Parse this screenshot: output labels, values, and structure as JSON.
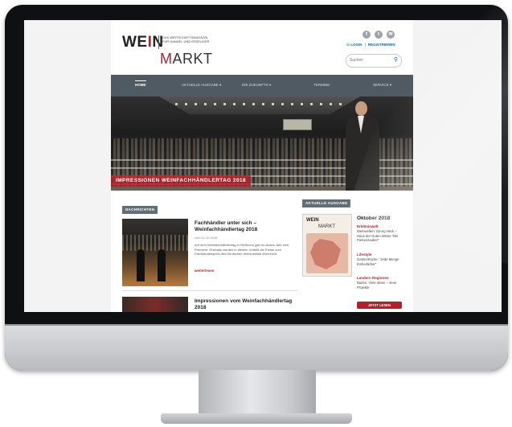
{
  "header": {
    "logo_wein": "WEIN",
    "logo_tagline": "DAS WIRTSCHAFTSMAGAZIN FÜR HANDEL UND ERZEUGER",
    "logo_markt": "MARKT",
    "social_icons": [
      "facebook-icon",
      "twitter-icon",
      "mail-icon"
    ],
    "login_label": "LOGIN",
    "register_label": "REGISTRIEREN",
    "search_placeholder": "Suchen"
  },
  "nav": {
    "items": [
      {
        "label": "HOME"
      },
      {
        "label": "AKTUELLE AUSGABE ▾"
      },
      {
        "label": "DIE ZUKUNFTS ▾"
      },
      {
        "label": "TERMINE"
      },
      {
        "label": "SERVICE ▾"
      }
    ]
  },
  "hero": {
    "caption": "IMPRESSIONEN WEINFACHHÄNDLERTAG 2018"
  },
  "news": {
    "section_label": "NACHRICHTEN",
    "articles": [
      {
        "title": "Fachhändler unter sich – Weinfachhändlertag 2018",
        "date": "vom 11.10.2018",
        "teaser": "Auf dem Weinfachhändlertag in Heilbronn gab es dieses Jahr eine Premiere: Erstmals wurden in diesem Umfeld die Preise zum Fachhandelspreis des Deutschen Weininstituts überreicht.",
        "more": "weiterlesen"
      },
      {
        "title": "Impressionen vom Weinfachhändlertag 2018"
      }
    ]
  },
  "issue": {
    "section_label": "AKTUELLE AUSGABE",
    "cover_wein": "WEIN",
    "cover_markt": "MARKT",
    "month": "Oktober 2018",
    "items": [
      {
        "category": "Erlebniswelt",
        "desc": "Weinwelten: Georg Heck – Haus der Guten Weine \"Die Parkenzauber\""
      },
      {
        "category": "Lifestyle",
        "desc": "Gastro/Küche: \"Jede Menge Einheitlicher\""
      },
      {
        "category": "Landern Regionen",
        "desc": "Baden: Viele Ideen – neue Projekte"
      }
    ],
    "read_button": "JETZT LESEN"
  }
}
